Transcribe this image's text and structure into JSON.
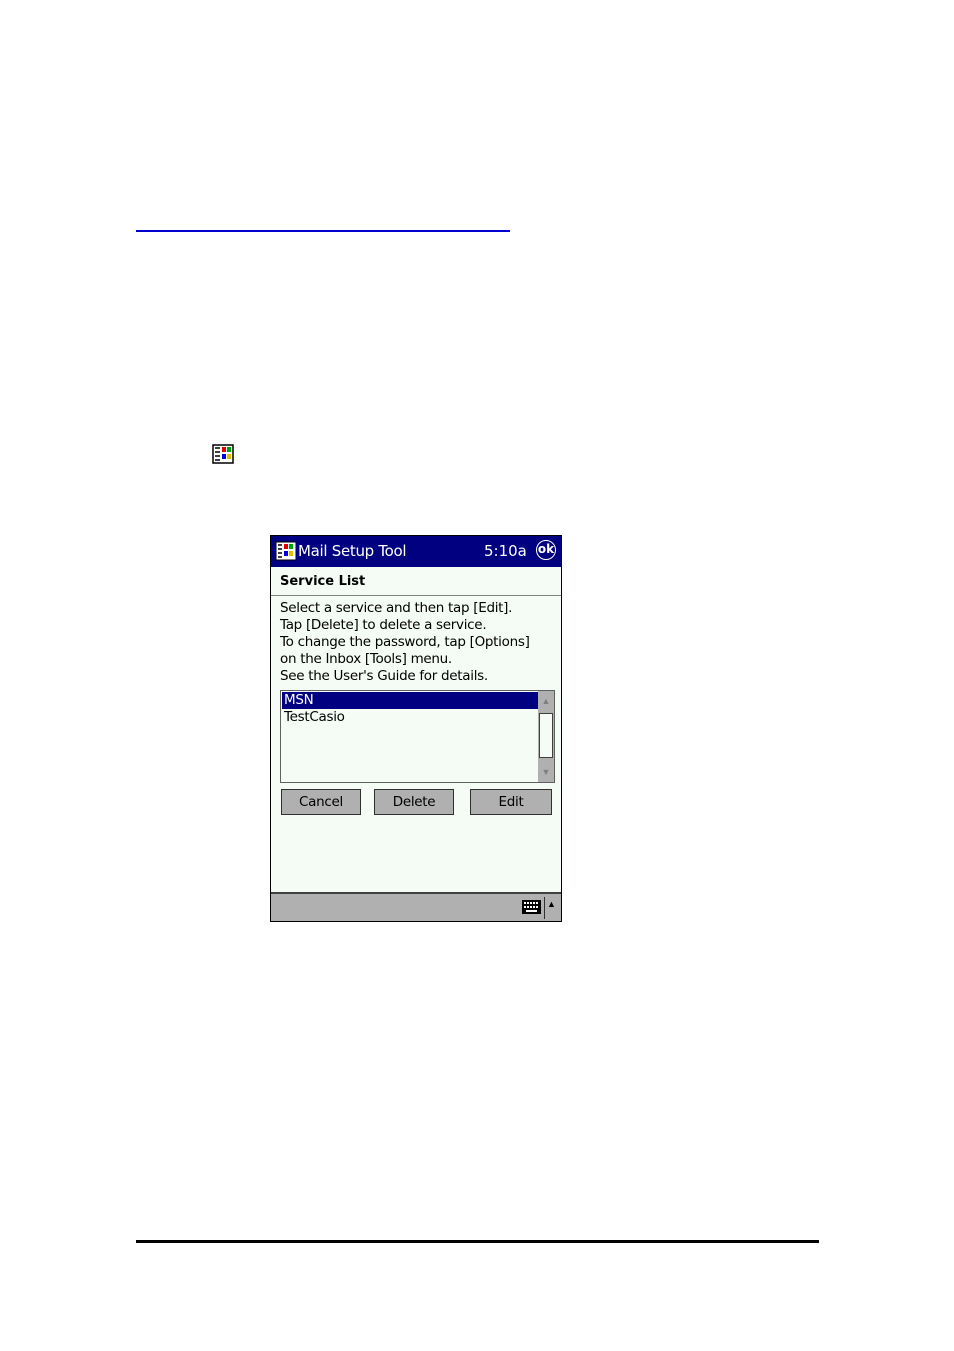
{
  "document": {
    "top_rule_color": "#0000cc",
    "bottom_rule_color": "#000000",
    "inline_icon": "start-menu-icon"
  },
  "device": {
    "titlebar": {
      "app_title": "Mail Setup Tool",
      "clock": "5:10a",
      "ok_label": "ok",
      "start_icon": "windows-start-icon",
      "color": "#000080"
    },
    "header": {
      "section_title": "Service List"
    },
    "instructions": [
      "Select a service and then tap [Edit].",
      "Tap [Delete] to delete a service.",
      "To change the password, tap [Options]",
      "on the Inbox [Tools] menu.",
      "See the User's Guide for details."
    ],
    "service_list": {
      "items": [
        {
          "label": "MSN",
          "selected": true
        },
        {
          "label": "TestCasio",
          "selected": false
        }
      ]
    },
    "buttons": {
      "cancel": "Cancel",
      "delete": "Delete",
      "edit": "Edit"
    },
    "taskbar": {
      "keyboard_icon": "keyboard-icon",
      "sip_arrow": "▲"
    }
  }
}
